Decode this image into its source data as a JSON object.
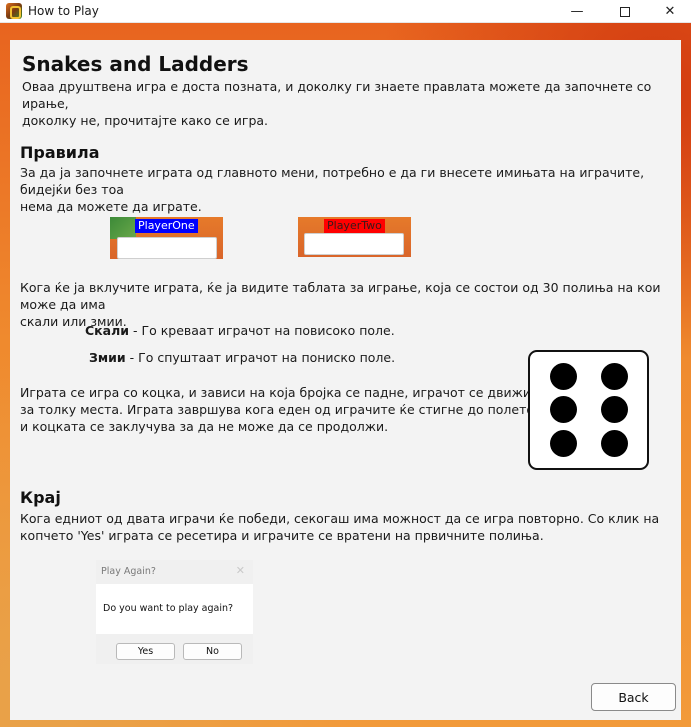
{
  "window": {
    "title": "How to Play",
    "minimize": "—",
    "close": "✕"
  },
  "content": {
    "title": "Snakes and Ladders",
    "intro": [
      "Оваа друштвена игра е доста позната, и доколку ги знаете правлата можете да започнете со ирање,",
      "доколку не, прочитајте како се игра."
    ],
    "rules_heading": "Правила",
    "rules_p1": [
      "За да ја започнете играта од главното мени, потребно е да ги внесете имињата на играчите, бидејќи без тоа",
      "нема да можете да играте."
    ],
    "player_one_label": "PlayerOne",
    "player_two_label": "PlayerTwo",
    "rules_p2": [
      "Кога ќе ја вклучите играта, ќе ја видите таблата за играње, која се состои од 30 полиња на кои може да има",
      "скали или змии."
    ],
    "ladders_term": "Скали",
    "ladders_desc": " - Го креваат играчот на повисоко поле.",
    "snakes_term": "Змии",
    "snakes_desc": " - Го спуштаат играчот на пониско поле.",
    "rules_p3": [
      "Играта се игра со коцка, и зависи на која бројка се падне, играчот се движи",
      "за толку места. Играта завршува кога еден од играчите ќе стигне до полето 30,",
      "и коцката се заклучува за да не може да се продолжи."
    ],
    "end_heading": "Крај",
    "end_p": [
      "Кога едниот од двата играчи ќе победи, секогаш има можност да се игра повторно. Со клик на",
      "копчето 'Yes' играта се ресетира и играчите се вратени на првичните полиња."
    ]
  },
  "dialog": {
    "title": "Play Again?",
    "close": "✕",
    "question": "Do you want to play again?",
    "yes": "Yes",
    "no": "No"
  },
  "dice_value": 6,
  "back_button": "Back",
  "colors": {
    "player_one_bg": "#0000ff",
    "player_two_bg": "#ff0000",
    "frame_orange": "#e8641f"
  }
}
